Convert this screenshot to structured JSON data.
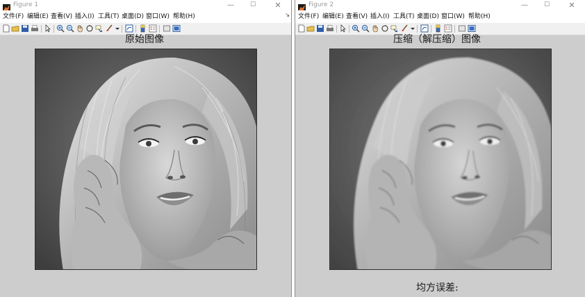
{
  "windows": [
    {
      "title": "Figure 1",
      "menus": [
        "文件(F)",
        "编辑(E)",
        "查看(V)",
        "插入(I)",
        "工具(T)",
        "桌面(D)",
        "窗口(W)",
        "帮助(H)"
      ],
      "axes_title": "原始图像",
      "image_kind": "original-grayscale-portrait",
      "xlabel": ""
    },
    {
      "title": "Figure 2",
      "menus": [
        "文件(F)",
        "编辑(E)",
        "查看(V)",
        "插入(I)",
        "工具(T)",
        "桌面(D)",
        "窗口(W)",
        "帮助(H)"
      ],
      "axes_title": "压缩（解压缩）图像",
      "image_kind": "compressed-grayscale-portrait",
      "xlabel": "均方误差:"
    }
  ],
  "toolbar_icons": [
    "new-figure-icon",
    "open-file-icon",
    "save-icon",
    "print-icon",
    "edit-plot-icon",
    "zoom-in-icon",
    "zoom-out-icon",
    "pan-icon",
    "rotate-3d-icon",
    "data-cursor-icon",
    "brush-icon",
    "link-plot-icon",
    "colorbar-icon",
    "legend-icon",
    "hide-plot-tools-icon",
    "show-plot-tools-icon"
  ],
  "colors": {
    "canvas": "#cdcdcd",
    "toolbar": "#f0f0f0",
    "titlebar": "#ffffff"
  }
}
